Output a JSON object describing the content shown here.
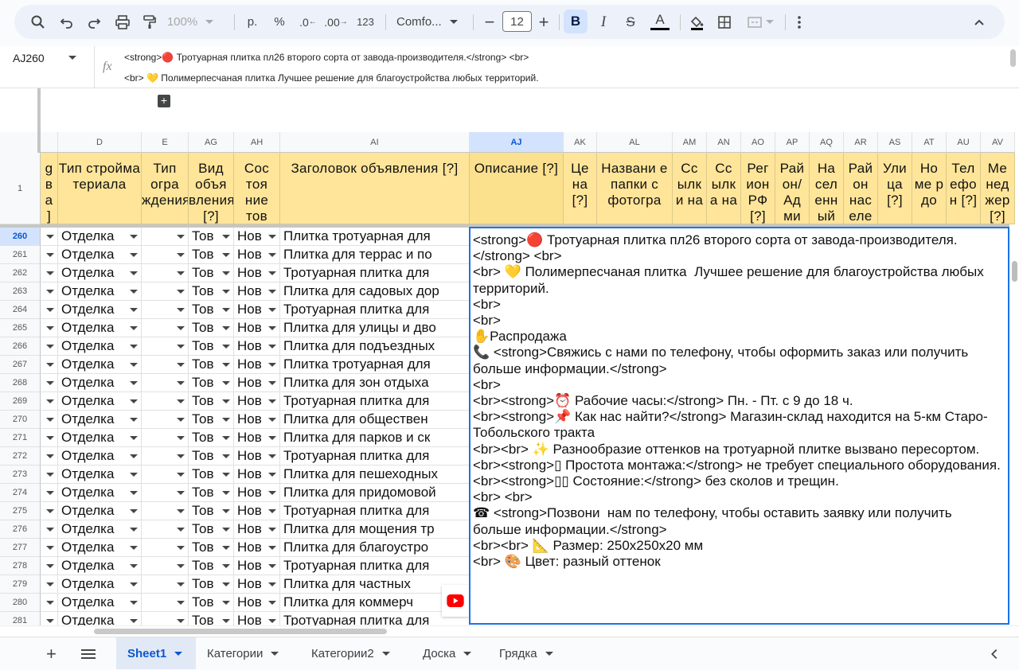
{
  "toolbar": {
    "zoom": "100%",
    "currency": "р.",
    "percent": "%",
    "dec_decrease": ".0",
    "dec_increase": ".00",
    "number_format": "123",
    "font_name": "Comfo...",
    "font_size": "12",
    "bold": "B",
    "italic": "I",
    "strike": "S",
    "text_color_letter": "A"
  },
  "namebox": {
    "value": "AJ260"
  },
  "formula_bar": {
    "fx": "fx",
    "line1": "<strong>🔴 Тротуарная плитка пл26 второго сорта от завода-производителя.</strong> <br>",
    "line2": "<br> 💛 Полимерпесчаная плитка  Лучшее решение для благоустройства любых территорий."
  },
  "columns": [
    {
      "letter": "",
      "header": "g\nв\nа\n]",
      "width": 22
    },
    {
      "letter": "D",
      "header": "Тип стройма териала",
      "width": 105
    },
    {
      "letter": "E",
      "header": "Тип огра ждения",
      "width": 59
    },
    {
      "letter": "AG",
      "header": "Вид объя вления [?]",
      "width": 57
    },
    {
      "letter": "AH",
      "header": "Сос тоя ние тов",
      "width": 58
    },
    {
      "letter": "AI",
      "header": "Заголовок объявления [?]",
      "width": 238
    },
    {
      "letter": "AJ",
      "header": "Описание [?]",
      "width": 118
    },
    {
      "letter": "AK",
      "header": "Це на [?]",
      "width": 42
    },
    {
      "letter": "AL",
      "header": "Названи е папки с фотогра",
      "width": 95
    },
    {
      "letter": "AM",
      "header": "Сс ылк и на",
      "width": 43
    },
    {
      "letter": "AN",
      "header": "Сс ылк а на",
      "width": 43
    },
    {
      "letter": "AO",
      "header": "Рег ион РФ [?]",
      "width": 43
    },
    {
      "letter": "AP",
      "header": "Рай он/ Ад ми",
      "width": 43
    },
    {
      "letter": "AQ",
      "header": "На сел енн ый",
      "width": 43
    },
    {
      "letter": "AR",
      "header": "Рай он нас еле",
      "width": 43
    },
    {
      "letter": "AS",
      "header": "Ули ца [?]",
      "width": 43
    },
    {
      "letter": "AT",
      "header": "Но ме р до",
      "width": 43
    },
    {
      "letter": "AU",
      "header": "Тел ефо н [?]",
      "width": 43
    },
    {
      "letter": "AV",
      "header": "Ме нед жер [?]",
      "width": 43
    }
  ],
  "row_numbers": [
    "260",
    "261",
    "262",
    "263",
    "264",
    "265",
    "266",
    "267",
    "268",
    "269",
    "270",
    "271",
    "272",
    "273",
    "274",
    "275",
    "276",
    "277",
    "278",
    "279",
    "280",
    "281"
  ],
  "rows": [
    {
      "d": "Отделка",
      "ag": "Тов",
      "ah": "Нов",
      "ai": "Плитка тротуарная для"
    },
    {
      "d": "Отделка",
      "ag": "Тов",
      "ah": "Нов",
      "ai": "Плитка для террас и по"
    },
    {
      "d": "Отделка",
      "ag": "Тов",
      "ah": "Нов",
      "ai": "Тротуарная плитка для"
    },
    {
      "d": "Отделка",
      "ag": "Тов",
      "ah": "Нов",
      "ai": "Плитка для садовых дор"
    },
    {
      "d": "Отделка",
      "ag": "Тов",
      "ah": "Нов",
      "ai": "Тротуарная плитка для"
    },
    {
      "d": "Отделка",
      "ag": "Тов",
      "ah": "Нов",
      "ai": "Плитка для улицы и дво"
    },
    {
      "d": "Отделка",
      "ag": "Тов",
      "ah": "Нов",
      "ai": "Плитка для подъездных"
    },
    {
      "d": "Отделка",
      "ag": "Тов",
      "ah": "Нов",
      "ai": "Плитка тротуарная для"
    },
    {
      "d": "Отделка",
      "ag": "Тов",
      "ah": "Нов",
      "ai": "Плитка для зон отдыха"
    },
    {
      "d": "Отделка",
      "ag": "Тов",
      "ah": "Нов",
      "ai": "Тротуарная плитка для"
    },
    {
      "d": "Отделка",
      "ag": "Тов",
      "ah": "Нов",
      "ai": "Плитка для обществен"
    },
    {
      "d": "Отделка",
      "ag": "Тов",
      "ah": "Нов",
      "ai": "Плитка для парков и ск"
    },
    {
      "d": "Отделка",
      "ag": "Тов",
      "ah": "Нов",
      "ai": "Тротуарная плитка для"
    },
    {
      "d": "Отделка",
      "ag": "Тов",
      "ah": "Нов",
      "ai": "Плитка для пешеходных"
    },
    {
      "d": "Отделка",
      "ag": "Тов",
      "ah": "Нов",
      "ai": "Плитка для придомовой"
    },
    {
      "d": "Отделка",
      "ag": "Тов",
      "ah": "Нов",
      "ai": "Тротуарная плитка для"
    },
    {
      "d": "Отделка",
      "ag": "Тов",
      "ah": "Нов",
      "ai": "Плитка для мощения тр"
    },
    {
      "d": "Отделка",
      "ag": "Тов",
      "ah": "Нов",
      "ai": "Плитка для благоустро"
    },
    {
      "d": "Отделка",
      "ag": "Тов",
      "ah": "Нов",
      "ai": "Тротуарная плитка для"
    },
    {
      "d": "Отделка",
      "ag": "Тов",
      "ah": "Нов",
      "ai": "Плитка для частных"
    },
    {
      "d": "Отделка",
      "ag": "Тов",
      "ah": "Нов",
      "ai": "Плитка для коммерч"
    },
    {
      "d": "Отделка",
      "ag": "Тов",
      "ah": "Нов",
      "ai": "Тротуарная плитка для"
    }
  ],
  "editor_text": "<strong>🔴 Тротуарная плитка пл26 второго сорта от завода-производителя.</strong> <br>\n<br> 💛 Полимерпесчаная плитка  Лучшее решение для благоустройства любых территорий.\n<br>\n<br>\n✋Распродажа\n📞 <strong>Свяжись с нами по телефону, чтобы оформить заказ или получить больше информации.</strong>\n<br>\n<br><strong>⏰ Рабочие часы:</strong> Пн. - Пт. с 9 до 18 ч.\n<br><strong>📌 Как нас найти?</strong> Магазин-склад находится на 5-км Старо-Тобольского тракта\n<br><br> ✨ Разнообразие оттенков на тротуарной плитке вызвано пересортом.\n<br><strong>▯ Простота монтажа:</strong> не требует специального оборудования.\n<br><strong>▯▯ Состояние:</strong> без сколов и трещин.\n<br> <br>\n☎ <strong>Позвони  нам по телефону, чтобы оставить заявку или получить больше информации.</strong>\n<br><br> 📐 Размер: 250х250х20 мм\n<br> 🎨 Цвет: разный оттенок",
  "sheets": [
    "Sheet1",
    "Категории",
    "Категории2",
    "Доска",
    "Грядка"
  ],
  "colors": {
    "header_fill": "#ffe599",
    "selection": "#1a73e8",
    "accent": "#0b57d0"
  }
}
